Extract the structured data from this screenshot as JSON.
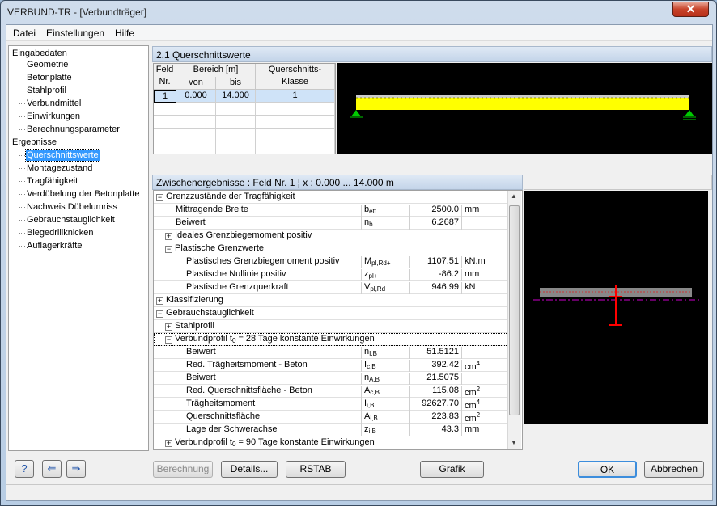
{
  "window": {
    "title": "VERBUND-TR - [Verbundträger]",
    "close_glyph": "✕"
  },
  "menu": [
    "Datei",
    "Einstellungen",
    "Hilfe"
  ],
  "tree": {
    "input_header": "Eingabedaten",
    "input_items": [
      "Geometrie",
      "Betonplatte",
      "Stahlprofil",
      "Verbundmittel",
      "Einwirkungen",
      "Berechnungsparameter"
    ],
    "results_header": "Ergebnisse",
    "results_items": [
      "Querschnittswerte",
      "Montagezustand",
      "Tragfähigkeit",
      "Verdübelung der Betonplatte",
      "Nachweis Dübelumriss",
      "Gebrauchstauglichkeit",
      "Biegedrillknicken",
      "Auflagerkräfte"
    ],
    "selected": "Querschnittswerte"
  },
  "section_title": "2.1 Querschnittswerte",
  "top_grid": {
    "h_feld": "Feld",
    "h_nr": "Nr.",
    "h_bereich": "Bereich [m]",
    "h_von": "von",
    "h_bis": "bis",
    "h_klasse1": "Querschnitts-",
    "h_klasse2": "Klasse",
    "row": {
      "nr": "1",
      "von": "0.000",
      "bis": "14.000",
      "klasse": "1"
    }
  },
  "interim": {
    "title": "Zwischenergebnisse :   Feld Nr. 1  ¦  x : 0.000 ... 14.000 m"
  },
  "results": {
    "g1": "Grenzzustände der Tragfähigkeit",
    "r1": {
      "label": "Mittragende Breite",
      "sym": "b",
      "sub": "eff",
      "val": "2500.0",
      "unit": "mm"
    },
    "r2": {
      "label": "Beiwert",
      "sym": "n",
      "sub": "b",
      "val": "6.2687",
      "unit": ""
    },
    "g2": "Ideales Grenzbiegemoment positiv",
    "g3": "Plastische Grenzwerte",
    "r3": {
      "label": "Plastisches Grenzbiegemoment positiv",
      "sym": "M",
      "sub": "pl,Rd+",
      "val": "1107.51",
      "unit": "kN.m"
    },
    "r4": {
      "label": "Plastische Nullinie positiv",
      "sym": "z",
      "sub": "pl+",
      "val": "-86.2",
      "unit": "mm"
    },
    "r5": {
      "label": "Plastische Grenzquerkraft",
      "sym": "V",
      "sub": "pl,Rd",
      "val": "946.99",
      "unit": "kN"
    },
    "g4": "Klassifizierung",
    "g5": "Gebrauchstauglichkeit",
    "g6": "Stahlprofil",
    "g7a": "Verbundprofil  t",
    "g7sub": "0",
    "g7b": " = 28 Tage   konstante Einwirkungen",
    "r6": {
      "label": "Beiwert",
      "sym": "n",
      "sub": "I,B",
      "val": "51.5121",
      "unit": ""
    },
    "r7": {
      "label": "Red. Trägheitsmoment - Beton",
      "sym": "I",
      "sub": "c,B",
      "val": "392.42",
      "unit": "cm",
      "sup": "4"
    },
    "r8": {
      "label": "Beiwert",
      "sym": "n",
      "sub": "A,B",
      "val": "21.5075",
      "unit": ""
    },
    "r9": {
      "label": "Red. Querschnittsfläche - Beton",
      "sym": "A",
      "sub": "c,B",
      "val": "115.08",
      "unit": "cm",
      "sup": "2"
    },
    "r10": {
      "label": "Trägheitsmoment",
      "sym": "I",
      "sub": "i,B",
      "val": "92627.70",
      "unit": "cm",
      "sup": "4"
    },
    "r11": {
      "label": "Querschnittsfläche",
      "sym": "A",
      "sub": "i,B",
      "val": "223.83",
      "unit": "cm",
      "sup": "2"
    },
    "r12": {
      "label": "Lage der Schwerachse",
      "sym": "z",
      "sub": "i,B",
      "val": "43.3",
      "unit": "mm"
    },
    "g8a": "Verbundprofil  t",
    "g8sub": "0",
    "g8b": " = 90 Tage   konstante Einwirkungen"
  },
  "buttons": {
    "berechnung": "Berechnung",
    "details": "Details...",
    "rstab": "RSTAB",
    "grafik": "Grafik",
    "ok": "OK",
    "abbrechen": "Abbrechen"
  },
  "colors": {
    "beam": "#ffff00",
    "support": "#00cc00",
    "slab": "#888888",
    "steel": "#ff0000",
    "axis": "#cc00cc"
  }
}
